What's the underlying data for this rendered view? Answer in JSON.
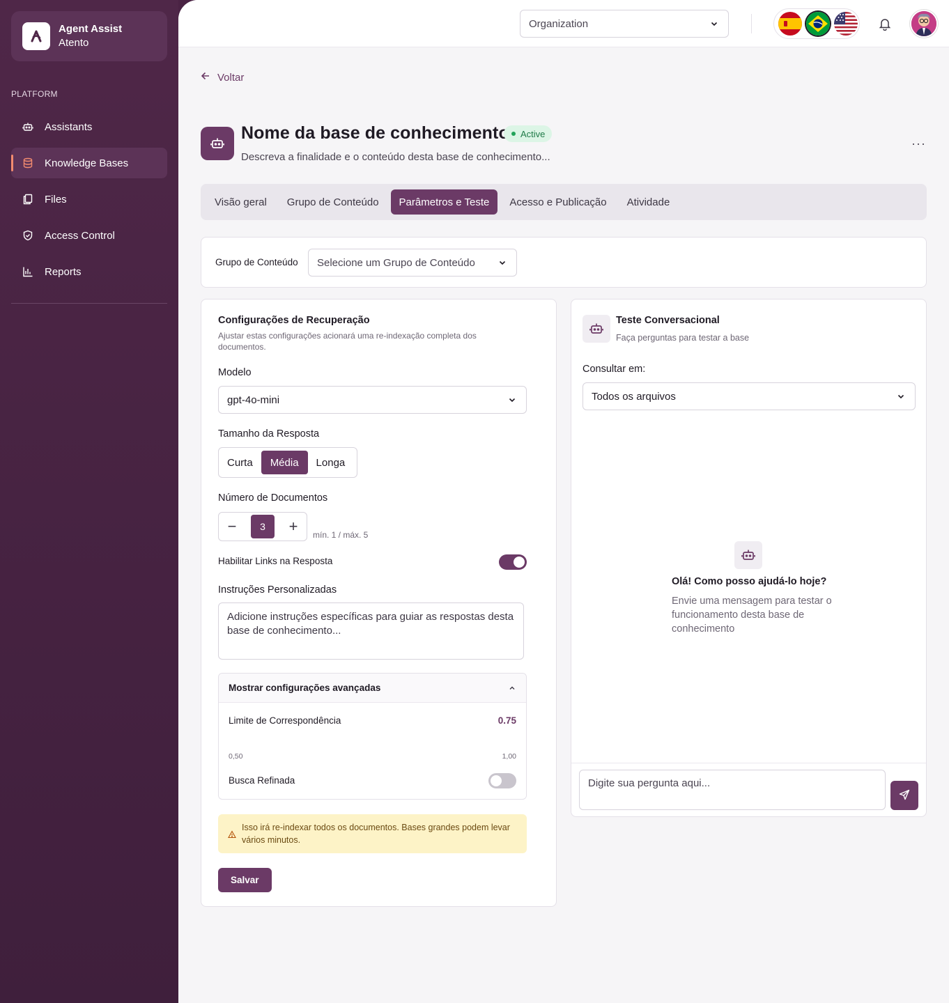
{
  "brand": {
    "title": "Agent Assist",
    "subtitle": "Atento",
    "logo_icon": "a-logo-icon"
  },
  "sidebar": {
    "section_label": "PLATFORM",
    "items": [
      {
        "label": "Assistants",
        "icon": "robot-icon",
        "active": false
      },
      {
        "label": "Knowledge Bases",
        "icon": "database-icon",
        "active": true
      },
      {
        "label": "Files",
        "icon": "files-icon",
        "active": false
      },
      {
        "label": "Access Control",
        "icon": "shield-icon",
        "active": false
      },
      {
        "label": "Reports",
        "icon": "chart-icon",
        "active": false
      }
    ]
  },
  "topbar": {
    "org_select_value": "Organization",
    "languages": [
      "Spanish flag",
      "Brazil flag",
      "USA flag"
    ],
    "selected_language": "Brazil flag"
  },
  "back_label": "Voltar",
  "kb": {
    "title": "Nome da base de conhecimento",
    "status": "Active",
    "description": "Descreva a finalidade e o conteúdo desta base de conhecimento...",
    "more_label": "···"
  },
  "tabs": [
    {
      "label": "Visão geral",
      "active": false
    },
    {
      "label": "Grupo de Conteúdo",
      "active": false
    },
    {
      "label": "Parâmetros e Teste",
      "active": true
    },
    {
      "label": "Acesso e Publicação",
      "active": false
    },
    {
      "label": "Atividade",
      "active": false
    }
  ],
  "content_group": {
    "label": "Grupo de Conteúdo",
    "placeholder": "Selecione um Grupo de Conteúdo"
  },
  "retrieval": {
    "title": "Configurações de Recuperação",
    "description": "Ajustar estas configurações acionará uma re-indexação completa dos documentos.",
    "model_label": "Modelo",
    "model_value": "gpt-4o-mini",
    "response_size_label": "Tamanho da Resposta",
    "response_sizes": [
      "Curta",
      "Média",
      "Longa"
    ],
    "response_size_selected": "Média",
    "doc_count_label": "Número de Documentos",
    "doc_count_value": "3",
    "doc_count_hint": "mín. 1 / máx. 5",
    "minus": "−",
    "plus": "+",
    "links_label": "Habilitar Links na Resposta",
    "links_enabled": true,
    "instructions_label": "Instruções Personalizadas",
    "instructions_placeholder": "Adicione instruções específicas para guiar as respostas desta base de conhecimento...",
    "advanced": {
      "title": "Mostrar configurações avançadas",
      "threshold_label": "Limite de Correspondência",
      "threshold_value": "0.75",
      "range_min": "0,50",
      "range_max": "1,00",
      "refined_label": "Busca Refinada",
      "refined_enabled": false
    },
    "warning": "Isso irá re-indexar todos os documentos. Bases grandes podem levar vários minutos.",
    "save_label": "Salvar"
  },
  "chat_test": {
    "title": "Teste Conversacional",
    "subtitle": "Faça perguntas para testar a base",
    "query_label": "Consultar em:",
    "query_value": "Todos os arquivos",
    "empty_title": "Olá! Como posso ajudá-lo hoje?",
    "empty_desc": "Envie uma mensagem para testar o funcionamento desta base de conhecimento",
    "input_placeholder": "Digite sua pergunta aqui..."
  },
  "colors": {
    "brand_purple": "#6b3a66",
    "sidebar_bg": "#4a2344",
    "active_accent": "#f28b6f",
    "status_green": "#22a35a",
    "warning_bg": "#fdf3c7"
  }
}
